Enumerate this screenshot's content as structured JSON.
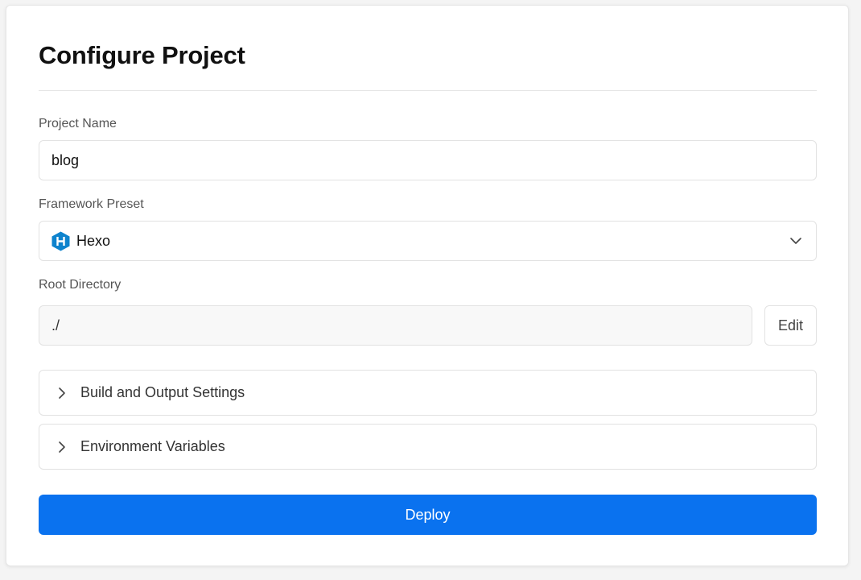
{
  "page": {
    "title": "Configure Project"
  },
  "project_name": {
    "label": "Project Name",
    "value": "blog"
  },
  "framework": {
    "label": "Framework Preset",
    "value": "Hexo",
    "icon": "hexo-logo-icon",
    "icon_color": "#0e83cd"
  },
  "root_directory": {
    "label": "Root Directory",
    "value": "./",
    "edit_label": "Edit"
  },
  "sections": [
    {
      "label": "Build and Output Settings",
      "icon": "chevron-right-icon"
    },
    {
      "label": "Environment Variables",
      "icon": "chevron-right-icon"
    }
  ],
  "deploy": {
    "label": "Deploy",
    "color": "#0a72ef"
  }
}
